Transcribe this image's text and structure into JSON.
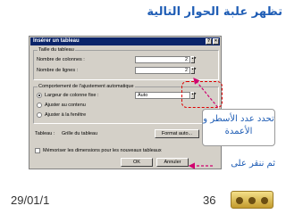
{
  "slide": {
    "title": "تظهر علبة الحوار التالية",
    "callout_rows_cols": "تحدد عدد الأسطر و الأعمدة",
    "callout_click": "ثم ننقر على",
    "date": "29/01/1",
    "page_number": "36"
  },
  "dialog": {
    "title": "Insérer un tableau",
    "size_group": "Taille du tableau",
    "columns_label": "Nombre de colonnes :",
    "columns_value": "2",
    "rows_label": "Nombre de lignes :",
    "rows_value": "2",
    "autofit_group": "Comportement de l'ajustement automatique",
    "option_fixed": "Largeur de colonne fixe :",
    "fixed_value": "Auto",
    "option_contents": "Ajuster au contenu",
    "option_window": "Ajuster à la fenêtre",
    "table_style_label": "Tableau :",
    "table_style_value": "Grille du tableau",
    "autoformat_button": "Format auto...",
    "remember_label": "Mémoriser les dimensions pour les nouveaux tableaux",
    "ok_button": "OK",
    "cancel_button": "Annuler"
  },
  "colors": {
    "title_text": "#1f5db5",
    "dialog_face": "#d4d0c8",
    "titlebar": "#0a246a",
    "arrow": "#d0006f"
  }
}
